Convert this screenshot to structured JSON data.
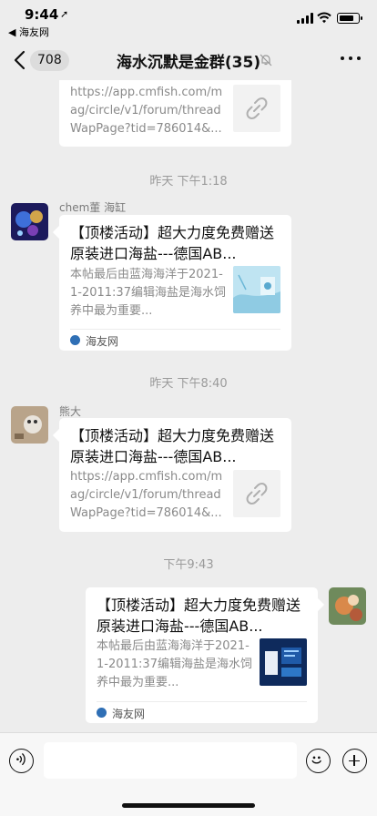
{
  "status": {
    "time": "9:44",
    "location_arrow": "➚",
    "back_app": "◀ 海友网"
  },
  "nav": {
    "unread_count": "708",
    "title": "海水沉默是金群(35)",
    "mute_icon": "bell-slash-icon",
    "more_icon": "more-dots-icon"
  },
  "messages": [
    {
      "kind": "link-card",
      "side": "left",
      "partial": true,
      "desc": "https://app.cmfish.com/mag/circle/v1/forum/threadWapPage?tid=786014&...",
      "thumb": "link-icon"
    },
    {
      "kind": "timestamp",
      "text": "昨天 下午1:18"
    },
    {
      "kind": "article-card",
      "side": "left",
      "sender": "chem董 海缸",
      "title": "【顶楼活动】超大力度免费赠送原装进口海盐---德国AB...",
      "desc": "本帖最后由蓝海海洋于2021-1-2011:37编辑海盐是海水饲养中最为重要...",
      "source": "海友网"
    },
    {
      "kind": "timestamp",
      "text": "昨天 下午8:40"
    },
    {
      "kind": "link-card",
      "side": "left",
      "sender": "熊大",
      "title": "【顶楼活动】超大力度免费赠送原装进口海盐---德国AB...",
      "desc": "https://app.cmfish.com/mag/circle/v1/forum/threadWapPage?tid=786014&...",
      "thumb": "link-icon"
    },
    {
      "kind": "timestamp",
      "text": "下午9:43"
    },
    {
      "kind": "article-card",
      "side": "right",
      "title": "【顶楼活动】超大力度免费赠送原装进口海盐---德国AB...",
      "desc": "本帖最后由蓝海海洋于2021-1-2011:37编辑海盐是海水饲养中最为重要...",
      "source": "海友网"
    }
  ],
  "input": {
    "placeholder": ""
  },
  "colors": {
    "background": "#ededed",
    "bubble": "#ffffff",
    "muted_text": "#8a8a8a"
  }
}
